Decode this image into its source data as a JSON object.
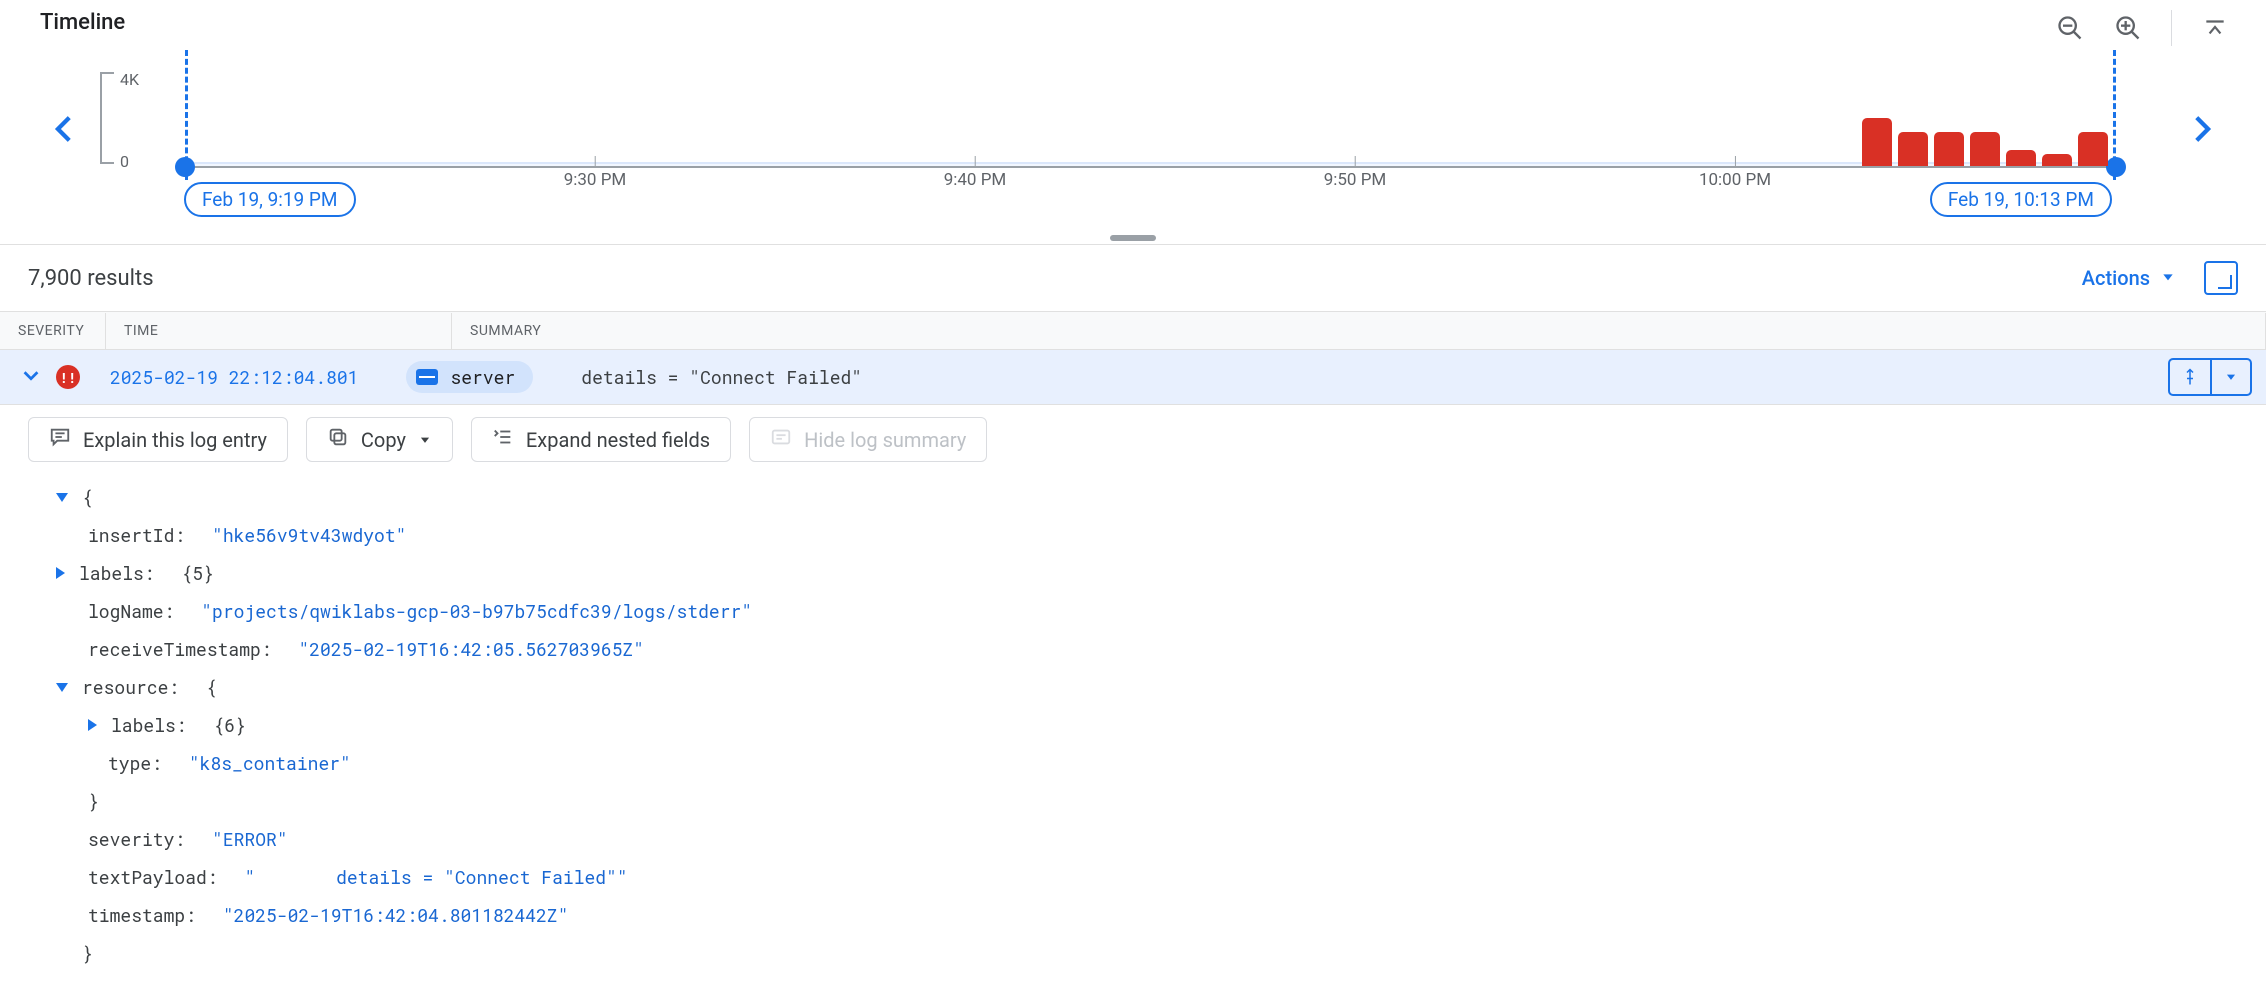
{
  "timeline": {
    "title": "Timeline",
    "y_max_label": "4K",
    "y_min_label": "0",
    "start_label": "Feb 19, 9:19 PM",
    "end_label": "Feb 19, 10:13 PM",
    "ticks": [
      "9:30 PM",
      "9:40 PM",
      "9:50 PM",
      "10:00 PM"
    ]
  },
  "chart_data": {
    "type": "bar",
    "title": "Timeline",
    "ylabel": "",
    "ylim": [
      0,
      4000
    ],
    "x_range": [
      "2025-02-19T21:19:00",
      "2025-02-19T22:13:00"
    ],
    "categories": [
      "22:06",
      "22:07",
      "22:08",
      "22:09",
      "22:10",
      "22:11",
      "22:12"
    ],
    "values": [
      2000,
      1400,
      1400,
      1400,
      700,
      500,
      1400
    ]
  },
  "results": {
    "count_label": "7,900 results",
    "actions_label": "Actions"
  },
  "table_head": {
    "severity": "SEVERITY",
    "time": "TIME",
    "summary": "SUMMARY"
  },
  "row": {
    "severity_glyph": "!!",
    "timestamp": "2025-02-19 22:12:04.801",
    "service": "server",
    "summary": "details = \"Connect Failed\""
  },
  "toolbar": {
    "explain": "Explain this log entry",
    "copy": "Copy",
    "expand": "Expand nested fields",
    "hide": "Hide log summary"
  },
  "log": {
    "open": "{",
    "insertId_k": "insertId:",
    "insertId_v": "\"hke56v9tv43wdyot\"",
    "labels_k": "labels:",
    "labels_v": "{5}",
    "logName_k": "logName:",
    "logName_v": "\"projects/qwiklabs-gcp-03-b97b75cdfc39/logs/stderr\"",
    "recvTs_k": "receiveTimestamp:",
    "recvTs_v": "\"2025-02-19T16:42:05.562703965Z\"",
    "resource_k": "resource:",
    "resource_open": "{",
    "res_labels_k": "labels:",
    "res_labels_v": "{6}",
    "res_type_k": "type:",
    "res_type_v": "\"k8s_container\"",
    "resource_close": "}",
    "severity_k": "severity:",
    "severity_v": "\"ERROR\"",
    "textPayload_k": "textPayload:",
    "textPayload_q": "\"",
    "textPayload_v": "details = \"Connect Failed\"\"",
    "ts_k": "timestamp:",
    "ts_v": "\"2025-02-19T16:42:04.801182442Z\"",
    "close": "}"
  }
}
